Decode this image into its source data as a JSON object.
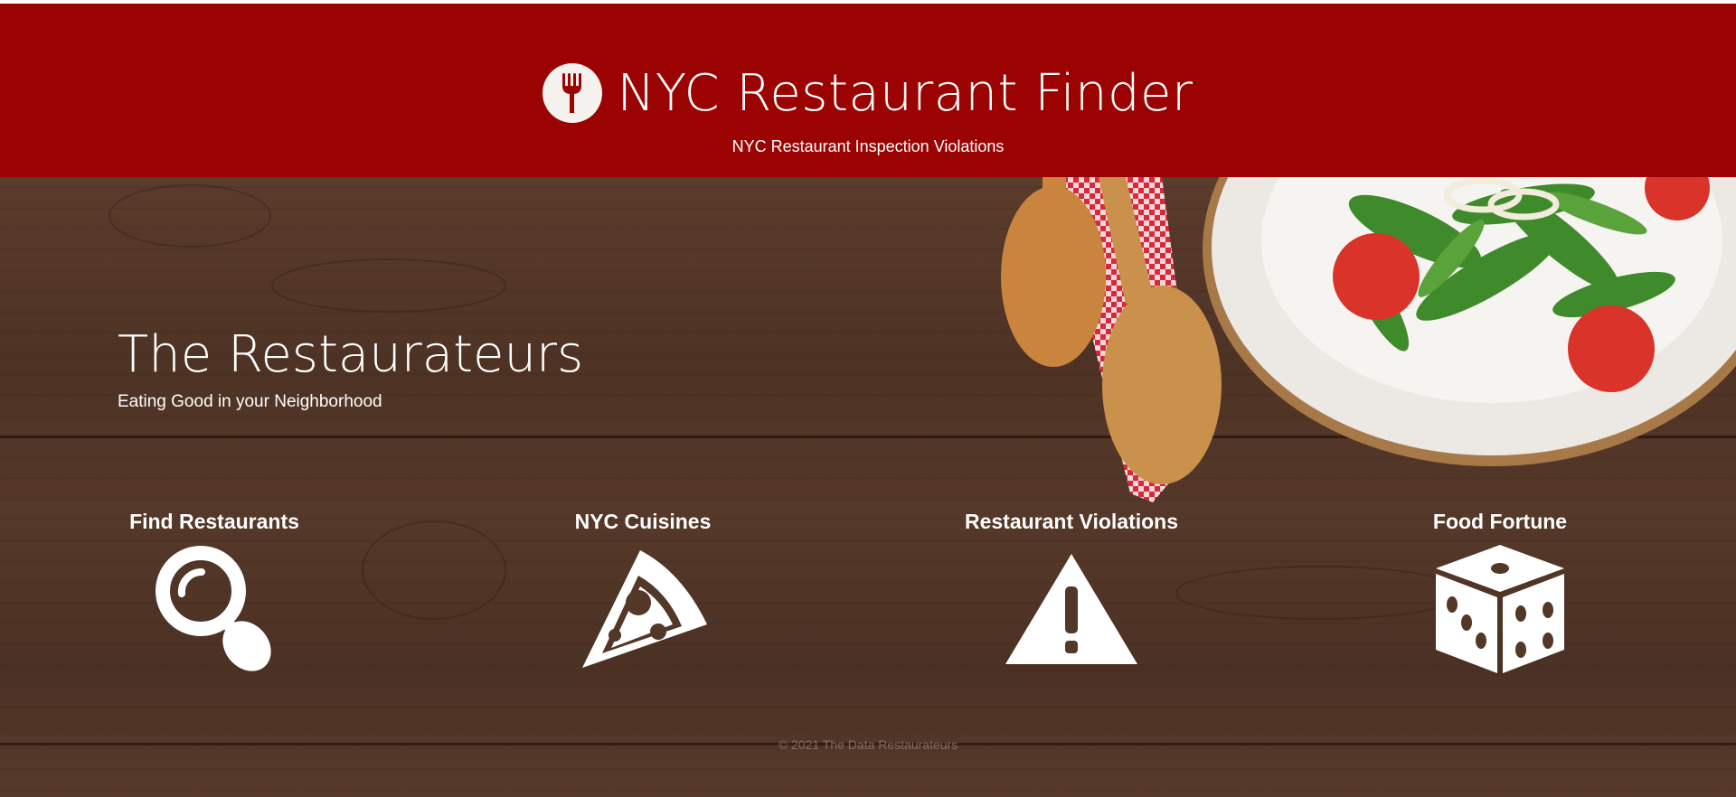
{
  "header": {
    "title": "NYC Restaurant Finder",
    "subtitle": "NYC Restaurant Inspection Violations",
    "logo_icon": "fork-icon"
  },
  "hero": {
    "title": "The Restaurateurs",
    "subtitle": "Eating Good in your Neighborhood"
  },
  "features": [
    {
      "label": "Find Restaurants",
      "icon": "magnifying-glass-icon"
    },
    {
      "label": "NYC Cuisines",
      "icon": "pizza-slice-icon"
    },
    {
      "label": "Restaurant Violations",
      "icon": "warning-triangle-icon"
    },
    {
      "label": "Food Fortune",
      "icon": "dice-icon"
    }
  ],
  "footer": {
    "copyright": "© 2021 The Data Restaurateurs"
  },
  "colors": {
    "header_bg": "#9b0303",
    "text": "#ffffff",
    "wood": "#553829"
  }
}
